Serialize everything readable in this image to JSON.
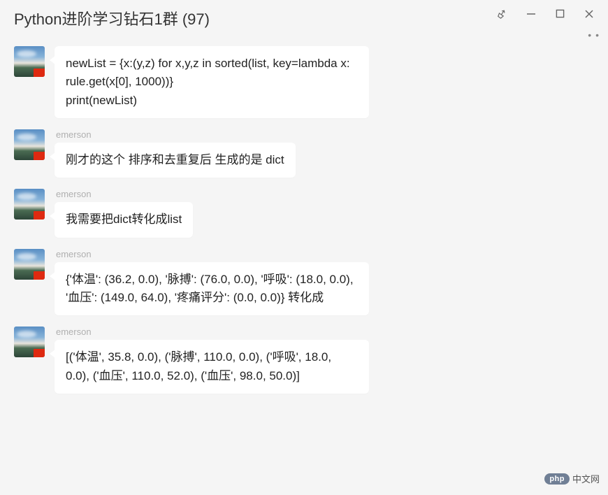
{
  "header": {
    "title": "Python进阶学习钻石1群 (97)"
  },
  "messages": [
    {
      "sender": "",
      "text": "newList = {x:(y,z) for x,y,z in sorted(list, key=lambda x: rule.get(x[0], 1000))}\nprint(newList)"
    },
    {
      "sender": "emerson",
      "text": "刚才的这个 排序和去重复后 生成的是 dict"
    },
    {
      "sender": "emerson",
      "text": "我需要把dict转化成list"
    },
    {
      "sender": "emerson",
      "text": "{'体温': (36.2, 0.0), '脉搏': (76.0, 0.0), '呼吸': (18.0, 0.0), '血压': (149.0, 64.0), '疼痛评分': (0.0, 0.0)}  转化成"
    },
    {
      "sender": "emerson",
      "text": " [('体温', 35.8, 0.0), ('脉搏', 110.0, 0.0), ('呼吸', 18.0, 0.0), ('血压', 110.0, 52.0), ('血压', 98.0, 50.0)]"
    }
  ],
  "watermark": {
    "badge": "php",
    "text": "中文网"
  }
}
